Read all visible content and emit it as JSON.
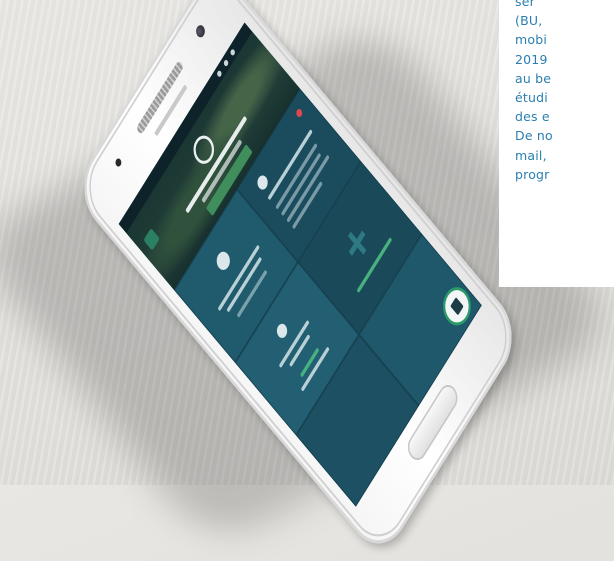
{
  "text_card": {
    "lines": [
      "ser",
      "(BU,",
      "mobi",
      "2019",
      "au be",
      "étudi",
      "des e",
      "De no",
      "mail,",
      "progr"
    ]
  },
  "colors": {
    "text_blue": "#2a7fb0",
    "screen_teal": "#1f5568",
    "accent_green": "#2a9a6a",
    "alert_red": "#e0484e"
  },
  "icons": [
    "menu-icon",
    "app-logo-icon",
    "plus-icon",
    "qr-code-icon",
    "clock-icon",
    "person-icon"
  ]
}
